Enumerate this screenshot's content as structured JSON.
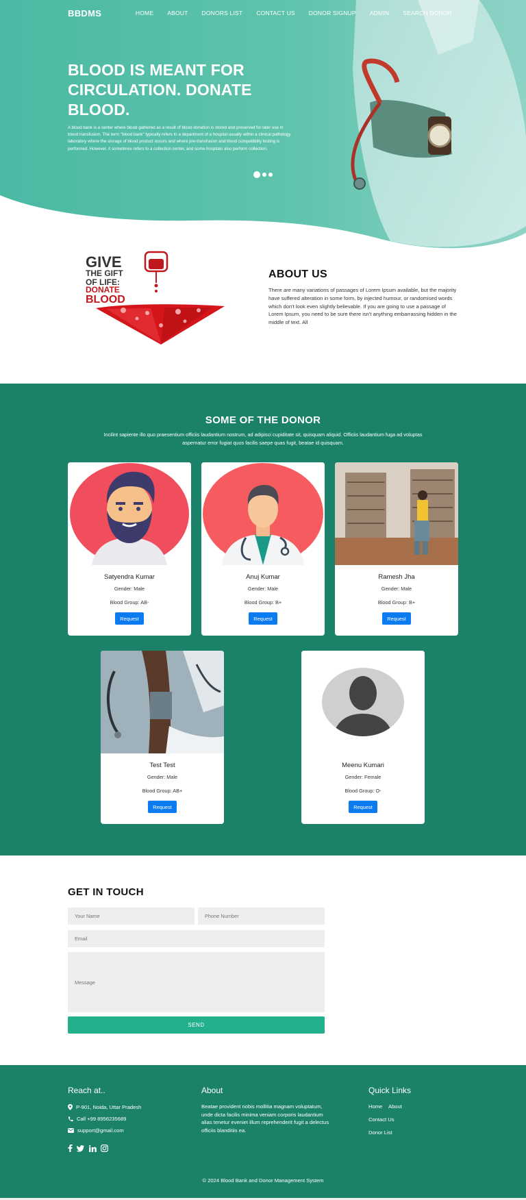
{
  "nav": {
    "brand": "BBDMS",
    "links": [
      "HOME",
      "ABOUT",
      "DONORS LIST",
      "CONTACT US",
      "DONOR SIGNUP",
      "ADMIN",
      "SEARCH DONOR"
    ]
  },
  "hero": {
    "title": "BLOOD IS MEANT FOR CIRCULATION. DONATE BLOOD.",
    "text": "A blood bank is a center where blood gathered as a result of blood donation is stored and preserved for later use in blood transfusion. The term \"blood bank\" typically refers to a department of a hospital usually within a clinical pathology laboratory where the storage of blood product occurs and where pre-transfusion and blood compatibility testing is performed. However, it sometimes refers to a collection center, and some hospitals also perform collection.",
    "slides": 3,
    "active_slide": 0
  },
  "about": {
    "image_text": [
      "GIVE",
      "THE GIFT",
      "OF LIFE:",
      "DONATE",
      "BLOOD"
    ],
    "title": "ABOUT US",
    "text": "There are many variations of passages of Lorem Ipsum available, but the majority have suffered alteration in some form, by injected humour, or randomised words which don't look even slightly believable. If you are going to use a passage of Lorem Ipsum, you need to be sure there isn't anything embarrassing hidden in the middle of text. All"
  },
  "donors": {
    "title": "SOME OF THE DONOR",
    "subtitle": "Incilint sapiente illo quo praesentium officiis laudantium nostrum, ad adipisci cupiditate sit, quisquam aliquid. Officiis laudantium fuga ad voluptas aspernatur error fugiat quos facilis saepe quas fugit, beatae id quisquam.",
    "cards": [
      {
        "name": "Satyendra Kumar",
        "gender": "Gender: Male",
        "blood": "Blood Group: AB-",
        "button": "Request"
      },
      {
        "name": "Anuj Kumar",
        "gender": "Gender: Male",
        "blood": "Blood Group: B+",
        "button": "Request"
      },
      {
        "name": "Ramesh Jha",
        "gender": "Gender: Male",
        "blood": "Blood Group: B+",
        "button": "Request"
      },
      {
        "name": "Test Test",
        "gender": "Gender: Male",
        "blood": "Blood Group: AB+",
        "button": "Request"
      },
      {
        "name": "Meenu Kumari",
        "gender": "Gender: Female",
        "blood": "Blood Group: O-",
        "button": "Request"
      }
    ]
  },
  "contact": {
    "title": "GET IN TOUCH",
    "name_placeholder": "Your Name",
    "phone_placeholder": "Phone Number",
    "email_placeholder": "Email",
    "message_placeholder": "Message",
    "send": "SEND"
  },
  "footer": {
    "reach_title": "Reach at..",
    "address": "P-901, Noida, Uttar Pradesh",
    "phone": "Call +99 8956235689",
    "email": "support@gmail.com",
    "about_title": "About",
    "about_text": "Beatae provident nobis mollitia magnam voluptatum, unde dicta facilis minima veniam corporis laudantium alias tenetur eveniet illum reprehenderit fugit a delectus officiis blanditiis ea.",
    "links_title": "Quick Links",
    "links": [
      "Home",
      "About",
      "Contact Us",
      "Donor List"
    ],
    "social_icons": [
      "facebook-icon",
      "twitter-icon",
      "linkedin-icon",
      "instagram-icon"
    ],
    "copyright": "© 2024 Blood Bank and Donor Management System"
  },
  "colors": {
    "teal_dark": "#1b8269",
    "teal_button": "#22b08c",
    "request_blue": "#0d7bf0"
  }
}
